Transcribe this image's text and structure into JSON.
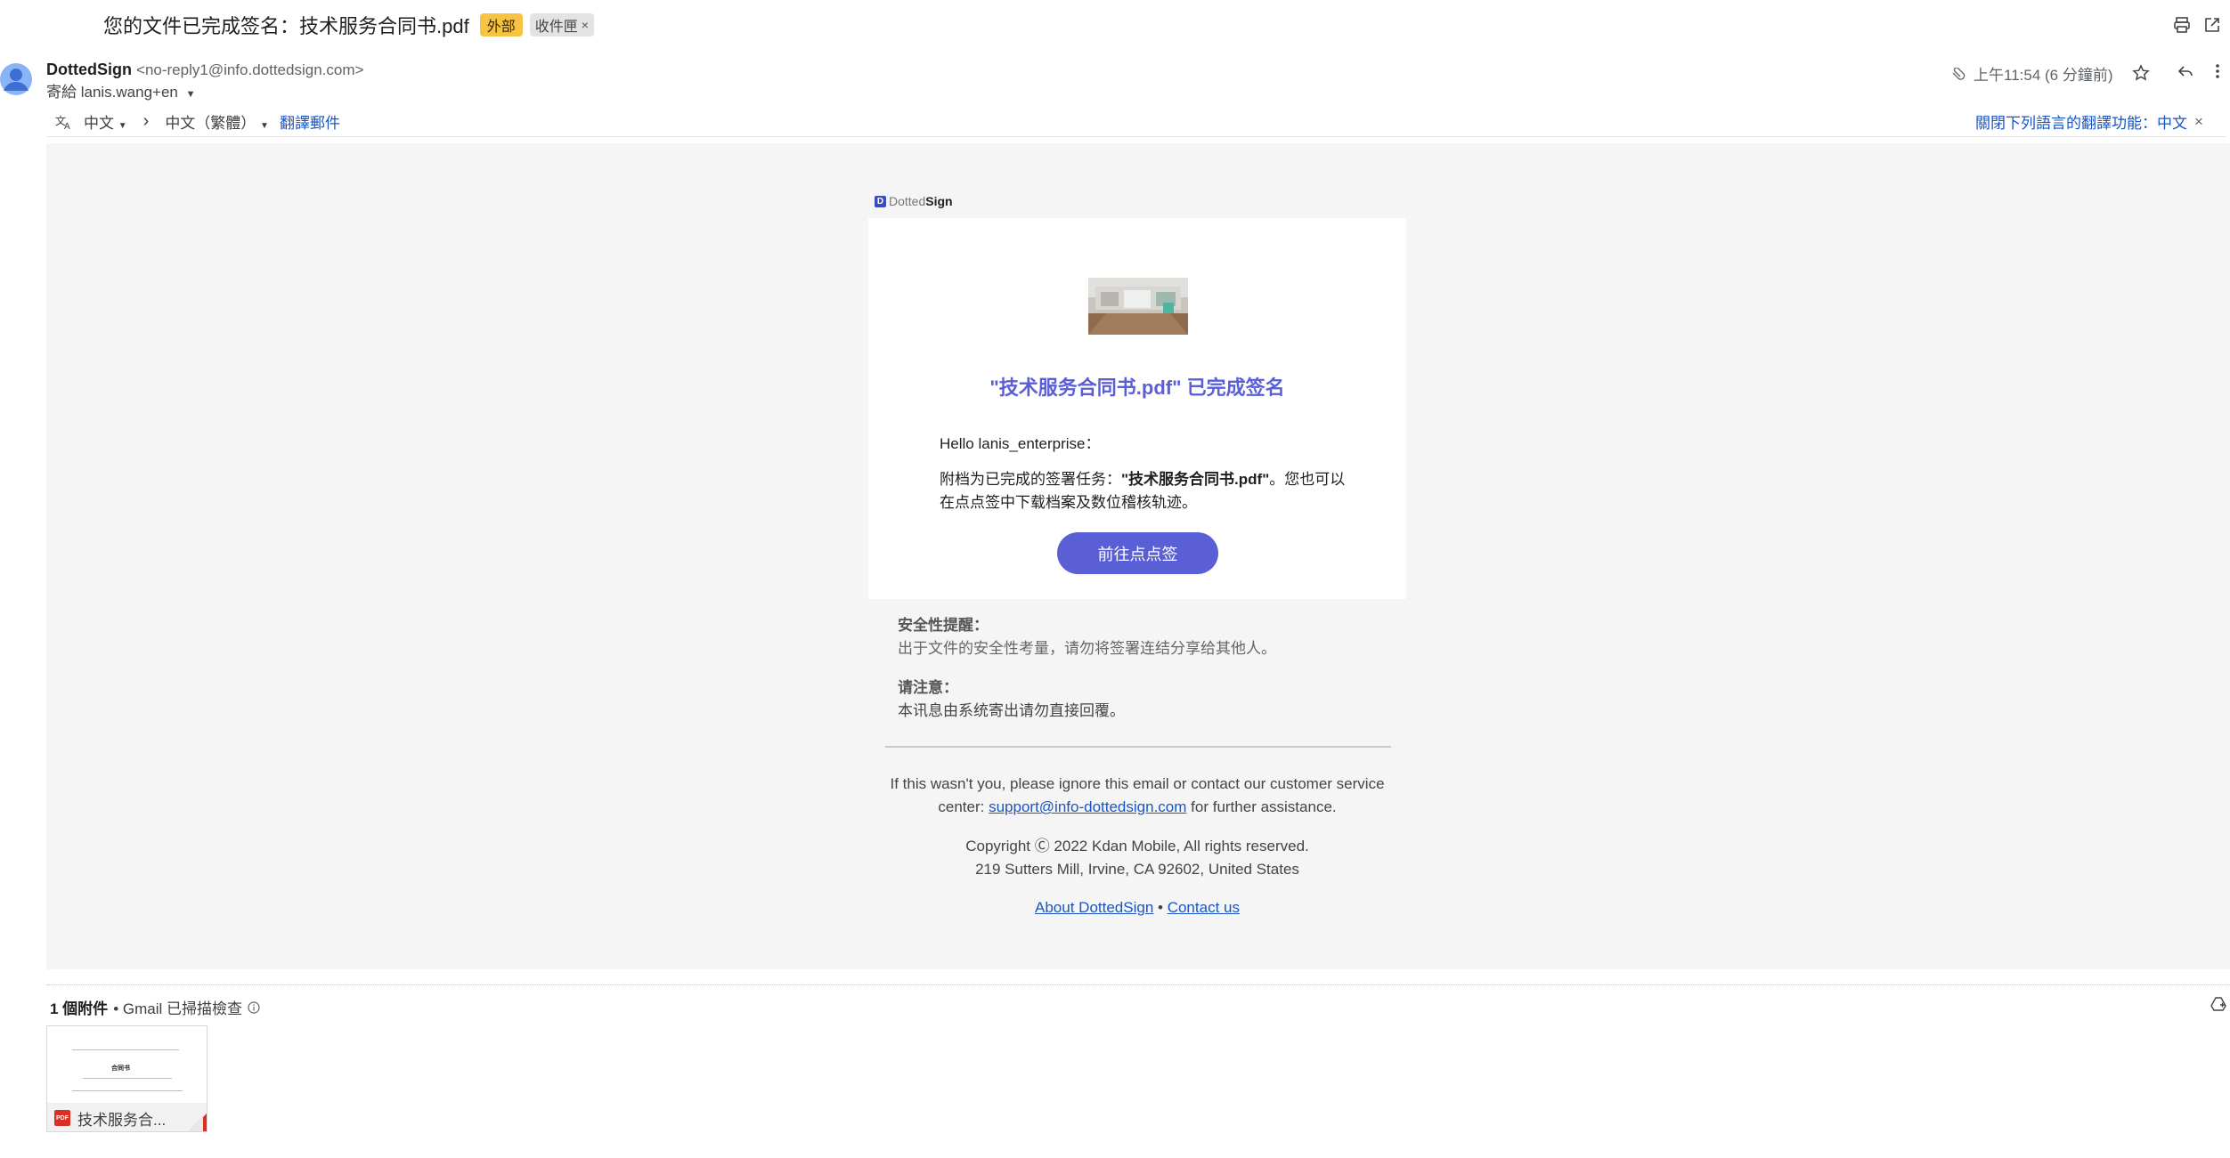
{
  "header": {
    "subject": "您的文件已完成签名：技术服务合同书.pdf",
    "tags": {
      "external": "外部",
      "inbox": "收件匣",
      "inbox_remove": "×"
    }
  },
  "message": {
    "sender_name": "DottedSign",
    "sender_email": "<no-reply1@info.dottedsign.com>",
    "to_line": "寄給 lanis.wang+en",
    "time": "上午11:54 (6 分鐘前)"
  },
  "translate_bar": {
    "from_lang": "中文",
    "to_lang": "中文（繁體）",
    "translate_link": "翻譯郵件",
    "disable_link": "關閉下列語言的翻譯功能：中文",
    "close": "×"
  },
  "email": {
    "logo_dotted": "Dotted",
    "logo_sign": "Sign",
    "title": "\"技术服务合同书.pdf\" 已完成签名",
    "greeting": "Hello lanis_enterprise：",
    "para_prefix": "附档为已完成的签署任务：",
    "para_file": "\"技术服务合同书.pdf\"",
    "para_suffix": "。您也可以在点点签中下载档案及数位稽核轨迹。",
    "cta": "前往点点签",
    "security_title": "安全性提醒：",
    "security_text": "出于文件的安全性考量，请勿将签署连结分享给其他人。",
    "notice_title": "请注意：",
    "notice_text": "本讯息由系统寄出请勿直接回覆。",
    "footer_line1": "If this wasn't you, please ignore this email or contact our customer service center:",
    "support_email": "support@info-dottedsign.com",
    "footer_line1_end": "for further assistance.",
    "copyright": "Copyright Ⓒ 2022 Kdan Mobile, All rights reserved.",
    "address": "219 Sutters Mill, Irvine, CA 92602, United States",
    "about_link": "About DottedSign",
    "link_sep": "•",
    "contact_link": "Contact us"
  },
  "attachments": {
    "count_label": "1 個附件",
    "scan_label": "• Gmail 已掃描檢查",
    "file_name": "技术服务合...",
    "file_type": "PDF"
  },
  "colors": {
    "accent": "#5a5fd6",
    "link": "#1a55c4",
    "external_tag": "#f6c342"
  }
}
